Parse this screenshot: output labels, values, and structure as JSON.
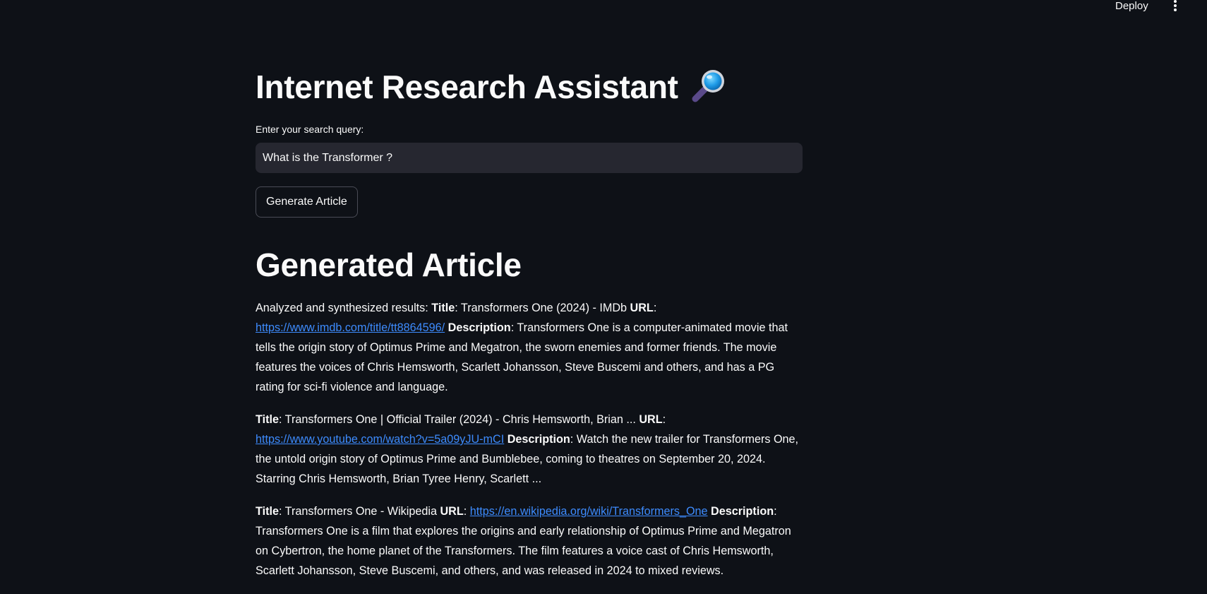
{
  "header": {
    "deploy_label": "Deploy",
    "menu_icon": "kebab-menu-icon"
  },
  "page": {
    "title": "Internet Research Assistant",
    "title_icon": "magnifying-glass-icon"
  },
  "search": {
    "label": "Enter your search query:",
    "value": "What is the Transformer ?"
  },
  "generate_button": {
    "label": "Generate Article"
  },
  "article": {
    "heading": "Generated Article",
    "intro": "Analyzed and synthesized results: ",
    "title_label": "Title",
    "url_label": "URL",
    "description_label": "Description",
    "results": [
      {
        "title": ": Transformers One (2024) - IMDb ",
        "url": "https://www.imdb.com/title/tt8864596/",
        "description": ": Transformers One is a computer-animated movie that tells the origin story of Optimus Prime and Megatron, the sworn enemies and former friends. The movie features the voices of Chris Hemsworth, Scarlett Johansson, Steve Buscemi and others, and has a PG rating for sci-fi violence and language."
      },
      {
        "title": ": Transformers One | Official Trailer (2024) - Chris Hemsworth, Brian ... ",
        "url": "https://www.youtube.com/watch?v=5a09yJU-mCI",
        "description": ": Watch the new trailer for Transformers One, the untold origin story of Optimus Prime and Bumblebee, coming to theatres on September 20, 2024. Starring Chris Hemsworth, Brian Tyree Henry, Scarlett ..."
      },
      {
        "title": ": Transformers One - Wikipedia ",
        "url": "https://en.wikipedia.org/wiki/Transformers_One",
        "description": ": Transformers One is a film that explores the origins and early relationship of Optimus Prime and Megatron on Cybertron, the home planet of the Transformers. The film features a voice cast of Chris Hemsworth, Scarlett Johansson, Steve Buscemi, and others, and was released in 2024 to mixed reviews."
      }
    ]
  },
  "colors": {
    "background": "#0e1117",
    "text": "#fafafa",
    "input_bg": "#262730",
    "link": "#3d8bfd"
  }
}
